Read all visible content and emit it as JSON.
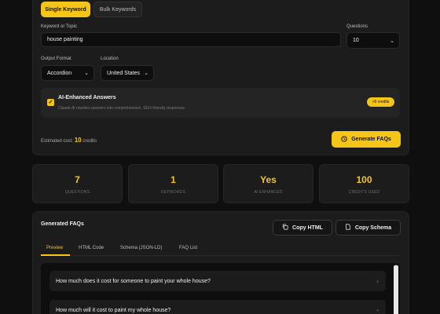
{
  "mode_tabs": {
    "single": "Single Keyword",
    "bulk": "Bulk Keywords"
  },
  "form": {
    "keyword_label": "Keyword or Topic",
    "keyword_value": "house painting",
    "questions_label": "Questions",
    "questions_value": "10",
    "output_label": "Output Format",
    "output_value": "Accordion",
    "location_label": "Location",
    "location_value": "United States"
  },
  "ai": {
    "title": "AI-Enhanced Answers",
    "description": "Claude AI rewrites answers into comprehensive, SEO-friendly responses",
    "badge": "+5 credits",
    "checked": true
  },
  "cost": {
    "prefix": "Estimated cost:",
    "value": "10",
    "unit": "credits"
  },
  "generate_label": "Generate FAQs",
  "stats": [
    {
      "value": "7",
      "label": "QUESTIONS"
    },
    {
      "value": "1",
      "label": "KEYWORDS"
    },
    {
      "value": "Yes",
      "label": "AI ENHANCED"
    },
    {
      "value": "100",
      "label": "CREDITS USED"
    }
  ],
  "results": {
    "title": "Generated FAQs",
    "copy_html": "Copy HTML",
    "copy_schema": "Copy Schema",
    "tabs": [
      "Preview",
      "HTML Code",
      "Schema (JSON-LD)",
      "FAQ List"
    ],
    "faqs": [
      "How much does it cost for someone to paint your whole house?",
      "How much will it cost to paint my whole house?"
    ]
  },
  "colors": {
    "accent": "#f5c518",
    "background": "#0f0f0f",
    "panel": "#1c1c1c"
  },
  "icons": {
    "generate": "clock-icon",
    "copy": "copy-icon",
    "expand": "plus-icon",
    "checkbox": "check-icon",
    "select": "chevron-down-icon"
  }
}
